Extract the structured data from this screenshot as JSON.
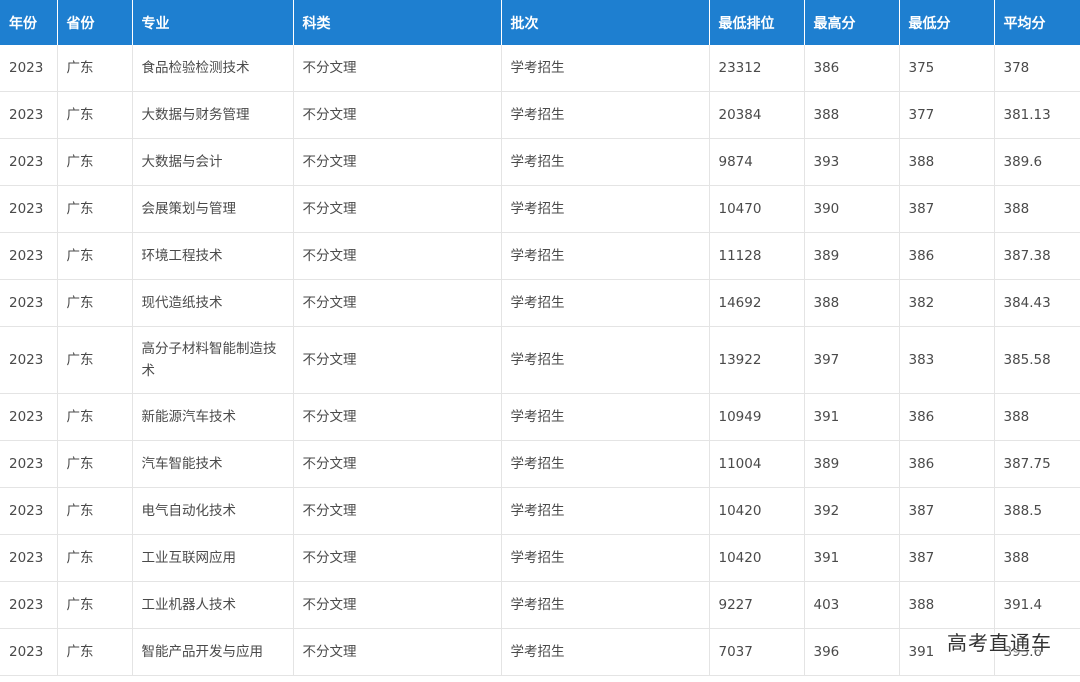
{
  "table": {
    "headers": [
      "年份",
      "省份",
      "专业",
      "科类",
      "批次",
      "最低排位",
      "最高分",
      "最低分",
      "平均分"
    ],
    "rows": [
      [
        "2023",
        "广东",
        "食品检验检测技术",
        "不分文理",
        "学考招生",
        "23312",
        "386",
        "375",
        "378"
      ],
      [
        "2023",
        "广东",
        "大数据与财务管理",
        "不分文理",
        "学考招生",
        "20384",
        "388",
        "377",
        "381.13"
      ],
      [
        "2023",
        "广东",
        "大数据与会计",
        "不分文理",
        "学考招生",
        "9874",
        "393",
        "388",
        "389.6"
      ],
      [
        "2023",
        "广东",
        "会展策划与管理",
        "不分文理",
        "学考招生",
        "10470",
        "390",
        "387",
        "388"
      ],
      [
        "2023",
        "广东",
        "环境工程技术",
        "不分文理",
        "学考招生",
        "11128",
        "389",
        "386",
        "387.38"
      ],
      [
        "2023",
        "广东",
        "现代造纸技术",
        "不分文理",
        "学考招生",
        "14692",
        "388",
        "382",
        "384.43"
      ],
      [
        "2023",
        "广东",
        "高分子材料智能制造技术",
        "不分文理",
        "学考招生",
        "13922",
        "397",
        "383",
        "385.58"
      ],
      [
        "2023",
        "广东",
        "新能源汽车技术",
        "不分文理",
        "学考招生",
        "10949",
        "391",
        "386",
        "388"
      ],
      [
        "2023",
        "广东",
        "汽车智能技术",
        "不分文理",
        "学考招生",
        "11004",
        "389",
        "386",
        "387.75"
      ],
      [
        "2023",
        "广东",
        "电气自动化技术",
        "不分文理",
        "学考招生",
        "10420",
        "392",
        "387",
        "388.5"
      ],
      [
        "2023",
        "广东",
        "工业互联网应用",
        "不分文理",
        "学考招生",
        "10420",
        "391",
        "387",
        "388"
      ],
      [
        "2023",
        "广东",
        "工业机器人技术",
        "不分文理",
        "学考招生",
        "9227",
        "403",
        "388",
        "391.4"
      ],
      [
        "2023",
        "广东",
        "智能产品开发与应用",
        "不分文理",
        "学考招生",
        "7037",
        "396",
        "391",
        "393.6"
      ]
    ]
  },
  "watermark": {
    "text": "高考直通车"
  },
  "colors": {
    "header_bg": "#1e7fd0",
    "header_text": "#ffffff",
    "cell_text": "#4a4a4a",
    "border": "#e4e4e4"
  }
}
